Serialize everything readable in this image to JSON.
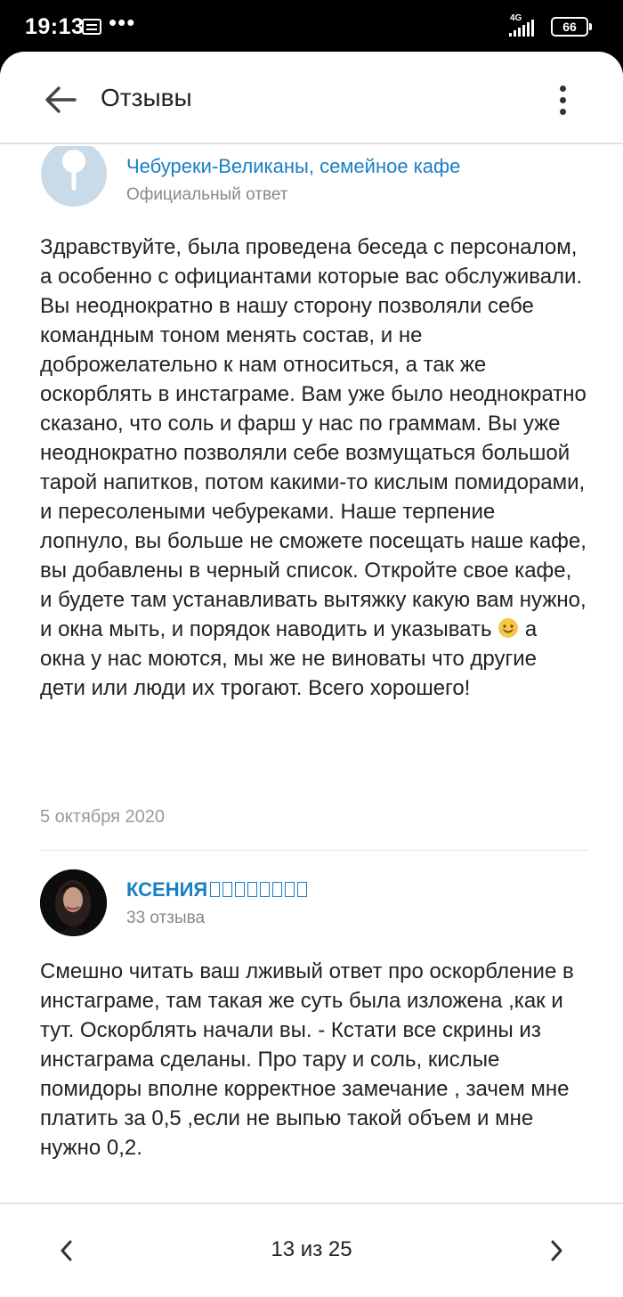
{
  "status_bar": {
    "time": "19:13",
    "dots": "•••",
    "network": "4G",
    "battery": "66"
  },
  "header": {
    "title": "Отзывы",
    "back_icon": "arrow-back-icon",
    "menu_icon": "more-vertical-icon"
  },
  "reviews": [
    {
      "author": "Чебуреки-Великаны, семейное кафе",
      "subtitle": "Официальный ответ",
      "avatar_icon": "pin-icon",
      "text": "Здравствуйте, была проведена беседа с персоналом, а особенно с официантами которые вас обслуживали. Вы неоднократно в нашу сторону позволяли себе командным тоном менять состав, и не доброжелательно к нам относиться, а так же оскорблять в инстаграме. Вам уже было неоднократно сказано, что соль и фарш у нас по граммам. Вы уже неоднократно позволяли себе возмущаться большой тарой напитков, потом какими-то кислым помидорами, и пересолеными чебуреками. Наше терпение лопнуло, вы больше не сможете посещать наше кафе, вы добавлены в черный список. Откройте свое кафе, и будете там устанавливать вытяжку какую вам нужно, и окна мыть, и порядок наводить и указывать",
      "text_after_emoji": " а окна у нас моются, мы же не виноваты что другие дети или люди их трогают. Всего хорошего!",
      "emoji": "smile-icon",
      "date": "5 октября 2020"
    },
    {
      "author": "КСЕНИЯ",
      "subtitle": "33 отзыва",
      "text": "Смешно читать ваш лживый ответ про оскорбление в инстаграме, там такая же суть была изложена ,как и тут. Оскорблять начали вы. - Кстати все скрины из инстаграма сделаны. Про тару и соль, кислые помидоры вполне корректное замечание , зачем мне платить за 0,5 ,если не выпью такой объем и мне нужно 0,2."
    }
  ],
  "pager": {
    "label": "13 из 25",
    "prev_icon": "chevron-left-icon",
    "next_icon": "chevron-right-icon"
  },
  "colors": {
    "link": "#1a7fc4",
    "text": "#222222",
    "muted": "#888888"
  }
}
